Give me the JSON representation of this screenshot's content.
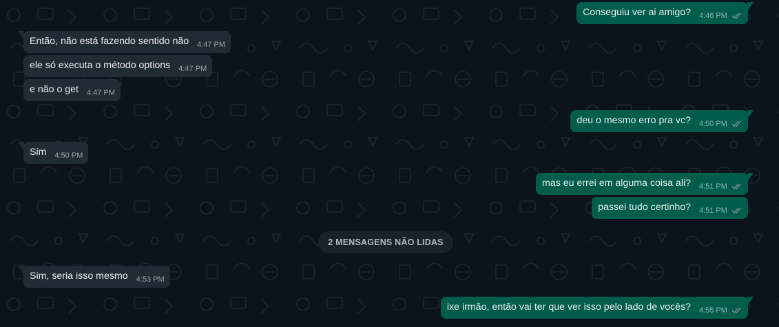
{
  "theme": {
    "background": "#0b141a",
    "incoming_bubble": "#202c33",
    "outgoing_bubble": "#005c4b",
    "text": "#e9edef"
  },
  "messages": [
    {
      "direction": "out",
      "text": "Conseguiu ver ai amigo?",
      "time": "4:46 PM",
      "status": "read-double-check-icon"
    },
    {
      "direction": "in",
      "text": "Então, não está fazendo sentido não",
      "time": "4:47 PM"
    },
    {
      "direction": "in",
      "text": "ele só executa o método options",
      "time": "4:47 PM"
    },
    {
      "direction": "in",
      "text": "e não o get",
      "time": "4:47 PM"
    },
    {
      "direction": "out",
      "text": "deu o mesmo erro pra vc?",
      "time": "4:50 PM",
      "status": "read-double-check-icon"
    },
    {
      "direction": "in",
      "text": "Sim",
      "time": "4:50 PM"
    },
    {
      "direction": "out",
      "text": "mas eu errei em alguma coisa ali?",
      "time": "4:51 PM",
      "status": "read-double-check-icon"
    },
    {
      "direction": "out",
      "text": "passei tudo certinho?",
      "time": "4:51 PM",
      "status": "read-double-check-icon"
    },
    {
      "direction": "in",
      "text": "Sim, seria isso mesmo",
      "time": "4:53 PM"
    },
    {
      "direction": "out",
      "text": "ixe irmão, então vai ter que ver isso pelo lado de vocês?",
      "time": "4:55 PM",
      "status": "read-double-check-icon"
    }
  ],
  "unread_divider": {
    "label": "2 MENSAGENS NÃO LIDAS"
  }
}
